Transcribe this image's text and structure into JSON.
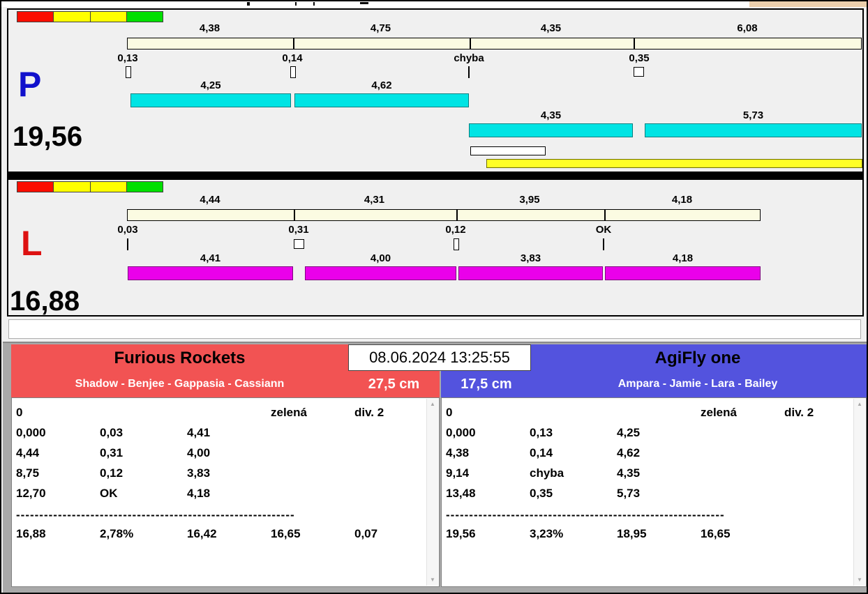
{
  "datetime": "08.06.2024 13:25:55",
  "panel_p": {
    "letter": "P",
    "total_time": "19,56",
    "split_times": [
      "4,38",
      "4,75",
      "4,35",
      "6,08"
    ],
    "change_times": [
      "0,13",
      "0,14",
      "chyba",
      "0,35"
    ],
    "run_times_row1": [
      "4,25",
      "4,62"
    ],
    "run_times_row2": [
      "4,35",
      "5,73"
    ]
  },
  "panel_l": {
    "letter": "L",
    "total_time": "16,88",
    "split_times": [
      "4,44",
      "4,31",
      "3,95",
      "4,18"
    ],
    "change_times": [
      "0,03",
      "0,31",
      "0,12",
      "OK"
    ],
    "run_times": [
      "4,41",
      "4,00",
      "3,83",
      "4,18"
    ]
  },
  "team_left": {
    "name": "Furious Rockets",
    "members": "Shadow - Benjee - Gappasia - Cassiann",
    "jump_height": "27,5 cm",
    "table": {
      "first_row": {
        "col1": "0",
        "col4": "zelená",
        "col5": "div. 2"
      },
      "rows": [
        [
          "0,000",
          "0,03",
          "4,41"
        ],
        [
          "4,44",
          "0,31",
          "4,00"
        ],
        [
          "8,75",
          "0,12",
          "3,83"
        ],
        [
          "12,70",
          "OK",
          "4,18"
        ]
      ],
      "separator": "------------------------------------------------------------",
      "totals": [
        "16,88",
        "2,78%",
        "16,42",
        "16,65",
        "0,07"
      ]
    }
  },
  "team_right": {
    "name": "AgiFly one",
    "members": "Ampara - Jamie - Lara - Bailey",
    "jump_height": "17,5 cm",
    "table": {
      "first_row": {
        "col1": "0",
        "col4": "zelená",
        "col5": "div. 2"
      },
      "rows": [
        [
          "0,000",
          "0,13",
          "4,25"
        ],
        [
          "4,38",
          "0,14",
          "4,62"
        ],
        [
          "9,14",
          "chyba",
          "4,35"
        ],
        [
          "13,48",
          "0,35",
          "5,73"
        ]
      ],
      "separator": "------------------------------------------------------------",
      "totals": [
        "19,56",
        "3,23%",
        "18,95",
        "16,65"
      ]
    }
  },
  "colors": {
    "cyan_bar": "#00e4e4",
    "magenta_bar": "#ea00ea",
    "ruler_bar": "#fbfbe2",
    "yellow_bar": "#ffff26",
    "team_left_header": "#f25353",
    "team_right_header": "#5353de",
    "letter_p": "#1111cc",
    "letter_l": "#dd1111",
    "traffic_light": [
      "#fb0d00",
      "#ffff00",
      "#ffff00",
      "#00df00"
    ]
  }
}
